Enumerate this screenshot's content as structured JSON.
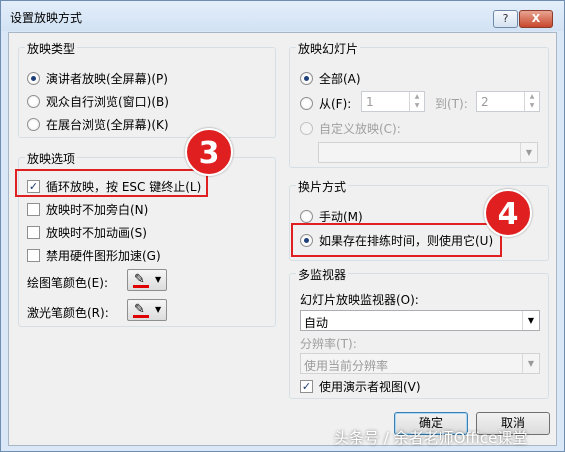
{
  "window": {
    "title": "设置放映方式",
    "help_label": "?",
    "close_label": "X"
  },
  "show_type": {
    "legend": "放映类型",
    "options": [
      {
        "label": "演讲者放映(全屏幕)(P)",
        "selected": true
      },
      {
        "label": "观众自行浏览(窗口)(B)",
        "selected": false
      },
      {
        "label": "在展台浏览(全屏幕)(K)",
        "selected": false
      }
    ]
  },
  "show_options": {
    "legend": "放映选项",
    "checkboxes": [
      {
        "label": "循环放映，按 ESC 键终止(L)",
        "checked": true
      },
      {
        "label": "放映时不加旁白(N)",
        "checked": false
      },
      {
        "label": "放映时不加动画(S)",
        "checked": false
      },
      {
        "label": "禁用硬件图形加速(G)",
        "checked": false
      }
    ],
    "pen_color_label": "绘图笔颜色(E):",
    "laser_color_label": "激光笔颜色(R):",
    "pen_color": "#e00000",
    "laser_color": "#e00000"
  },
  "slides": {
    "legend": "放映幻灯片",
    "all_label": "全部(A)",
    "from_label": "从(F):",
    "from_value": "1",
    "to_label": "到(T):",
    "to_value": "2",
    "custom_label": "自定义放映(C):",
    "custom_value": ""
  },
  "advance": {
    "legend": "换片方式",
    "manual_label": "手动(M)",
    "timings_label": "如果存在排练时间，则使用它(U)"
  },
  "monitors": {
    "legend": "多监视器",
    "monitor_label": "幻灯片放映监视器(O):",
    "monitor_value": "自动",
    "resolution_label": "分辨率(T):",
    "resolution_value": "使用当前分辨率",
    "presenter_view_label": "使用演示者视图(V)"
  },
  "buttons": {
    "ok": "确定",
    "cancel": "取消"
  },
  "annotations": {
    "badge_3": "3",
    "badge_4": "4",
    "highlight_color": "#e02020"
  },
  "watermark": "头条号 / 余者老师Office课堂"
}
